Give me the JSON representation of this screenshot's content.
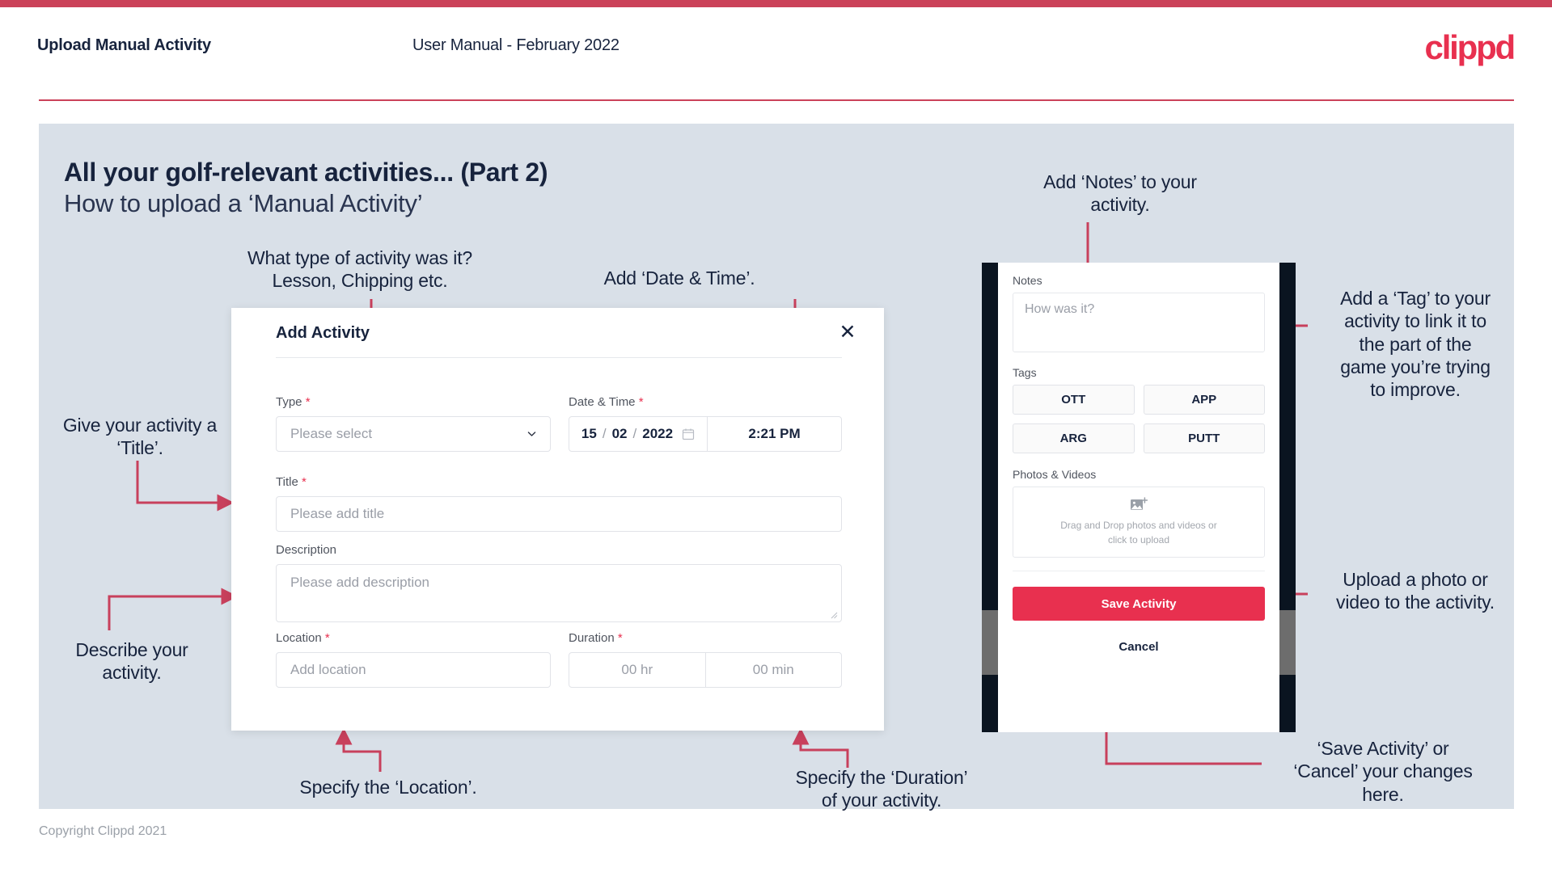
{
  "header": {
    "title": "Upload Manual Activity",
    "subtitle": "User Manual - February 2022",
    "brand": "clippd"
  },
  "slide": {
    "title": "All your golf-relevant activities... (Part 2)",
    "subtitle": "How to upload a ‘Manual Activity’"
  },
  "annotations": {
    "type": "What type of activity was it?\nLesson, Chipping etc.",
    "datetime": "Add ‘Date & Time’.",
    "title": "Give your activity a\n‘Title’.",
    "description": "Describe your\nactivity.",
    "location": "Specify the ‘Location’.",
    "duration": "Specify the ‘Duration’\nof your activity.",
    "notes": "Add ‘Notes’ to your\nactivity.",
    "tags": "Add a ‘Tag’ to your\nactivity to link it to\nthe part of the\ngame you’re trying\nto improve.",
    "upload": "Upload a photo or\nvideo to the activity.",
    "save": "‘Save Activity’ or\n‘Cancel’ your changes\nhere."
  },
  "dialog": {
    "title": "Add Activity",
    "close_icon": "close-icon",
    "fields": {
      "type": {
        "label": "Type",
        "required": "*",
        "placeholder": "Please select"
      },
      "datetime": {
        "label": "Date & Time",
        "required": "*",
        "day": "15",
        "month": "02",
        "year": "2022",
        "sep": "/",
        "time": "2:21 PM"
      },
      "title": {
        "label": "Title",
        "required": "*",
        "placeholder": "Please add title"
      },
      "description": {
        "label": "Description",
        "placeholder": "Please add description"
      },
      "location": {
        "label": "Location",
        "required": "*",
        "placeholder": "Add location"
      },
      "duration": {
        "label": "Duration",
        "required": "*",
        "hours": "00 hr",
        "minutes": "00 min"
      }
    }
  },
  "phone": {
    "notes": {
      "label": "Notes",
      "placeholder": "How was it?"
    },
    "tags": {
      "label": "Tags",
      "items": [
        "OTT",
        "APP",
        "ARG",
        "PUTT"
      ]
    },
    "photos": {
      "label": "Photos & Videos",
      "dropzone": "Drag and Drop photos and videos or click to upload"
    },
    "save_label": "Save Activity",
    "cancel_label": "Cancel"
  },
  "footer": {
    "copyright": "Copyright Clippd 2021"
  },
  "colors": {
    "accent": "#cb4259",
    "brand": "#e8304f",
    "slide_bg": "#d9e0e8",
    "text": "#17233d",
    "arrow": "#c8405c"
  }
}
